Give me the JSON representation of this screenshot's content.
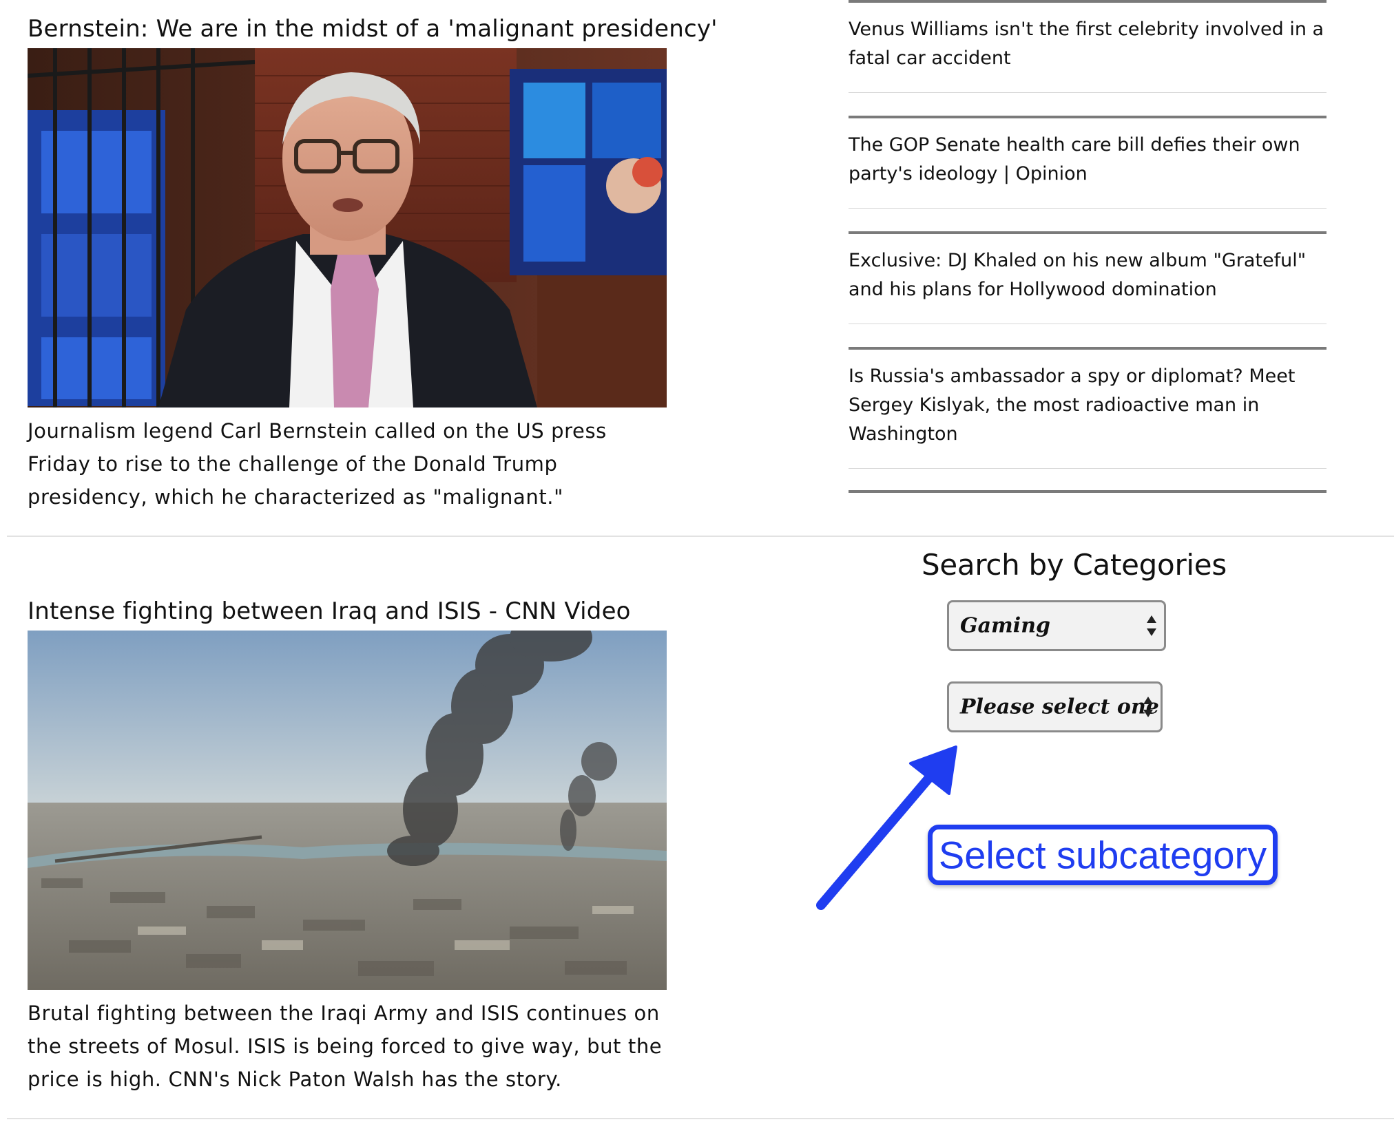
{
  "stories": [
    {
      "headline": "Bernstein: We are in the midst of a 'malignant presidency'",
      "summary": "Journalism legend Carl Bernstein called on the US press Friday to rise to the challenge of the Donald Trump presidency, which he characterized as \"malignant.\""
    },
    {
      "headline": "Intense fighting between Iraq and ISIS - CNN Video",
      "summary": "Brutal fighting between the Iraqi Army and ISIS continues on the streets of Mosul. ISIS is being forced to give way, but the price is high. CNN's Nick Paton Walsh has the story."
    }
  ],
  "related": [
    {
      "title": "Venus Williams isn't the first celebrity involved in a fatal car accident"
    },
    {
      "title": "The GOP Senate health care bill defies their own party's ideology | Opinion"
    },
    {
      "title": "Exclusive: DJ Khaled on his new album \"Grateful\" and his plans for Hollywood domination"
    },
    {
      "title": "Is Russia's ambassador a spy or diplomat? Meet Sergey Kislyak, the most radioactive man in Washington"
    }
  ],
  "categories": {
    "title": "Search by Categories",
    "category_value": "Gaming",
    "subcategory_value": "Please select one"
  },
  "annotation": {
    "label": "Select subcategory",
    "color": "#1f3df0"
  },
  "icons": {
    "select_arrows": "up-down-arrows-icon",
    "annotation_arrow": "pointer-arrow-icon"
  }
}
